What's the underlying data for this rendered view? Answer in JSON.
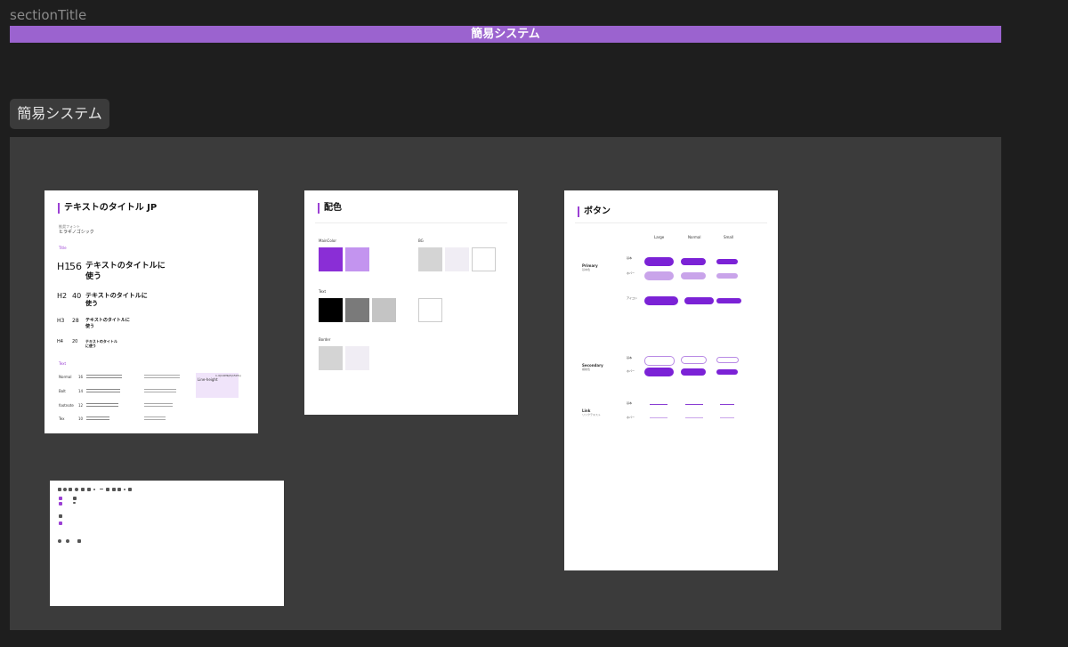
{
  "section": {
    "title": "sectionTitle",
    "banner": "簡易システム"
  },
  "frame": {
    "label": "簡易システム"
  },
  "typography": {
    "title": "テキストのタイトル JP",
    "font_label": "推奨フォント",
    "font_name": "ヒラギノゴシック",
    "title_group": "Title",
    "headings": [
      {
        "tag": "H1",
        "size": "56",
        "text": "テキストのタイトルに使う"
      },
      {
        "tag": "H2",
        "size": "40",
        "text": "テキストのタイトルに使う"
      },
      {
        "tag": "H3",
        "size": "28",
        "text": "テキストのタイトルに使う"
      },
      {
        "tag": "H4",
        "size": "20",
        "text": "テキストのタイトルに使う"
      }
    ],
    "text_group": "Text",
    "rows": [
      {
        "name": "Normal",
        "size": "16"
      },
      {
        "name": "Bolt",
        "size": "14"
      },
      {
        "name": "footnote",
        "size": "12"
      },
      {
        "name": "Tex",
        "size": "10"
      }
    ],
    "line_height": {
      "label": "Line-height",
      "v1": "1.4(140%)",
      "v2": "1.5(150%)"
    }
  },
  "colors": {
    "title": "配色",
    "main": {
      "label": "MainColor",
      "swatches": [
        "#8a2ed6",
        "#c394ef"
      ]
    },
    "bg": {
      "label": "BG",
      "swatches": [
        "#d4d4d4",
        "#f0edf4",
        "#ffffff"
      ]
    },
    "text": {
      "label": "Text",
      "swatches": [
        "#000000",
        "#7a7a7a",
        "#c4c4c4",
        "#ffffff"
      ]
    },
    "border": {
      "label": "Border",
      "swatches": [
        "#d4d4d4",
        "#f0edf4"
      ]
    }
  },
  "buttons": {
    "title": "ボタン",
    "sizes": [
      "Large",
      "Normal",
      "Small"
    ],
    "groups": [
      {
        "name": "Primary",
        "sub": "基本色",
        "states": [
          "基本",
          "ホバー",
          "アイコン"
        ]
      },
      {
        "name": "Secondary",
        "sub": "補助色",
        "states": [
          "基本",
          "ホバー"
        ]
      },
      {
        "name": "Link",
        "sub": "リンクテキスト",
        "states": [
          "基本",
          "ホバー"
        ]
      }
    ]
  },
  "accent": "#9b63cf"
}
